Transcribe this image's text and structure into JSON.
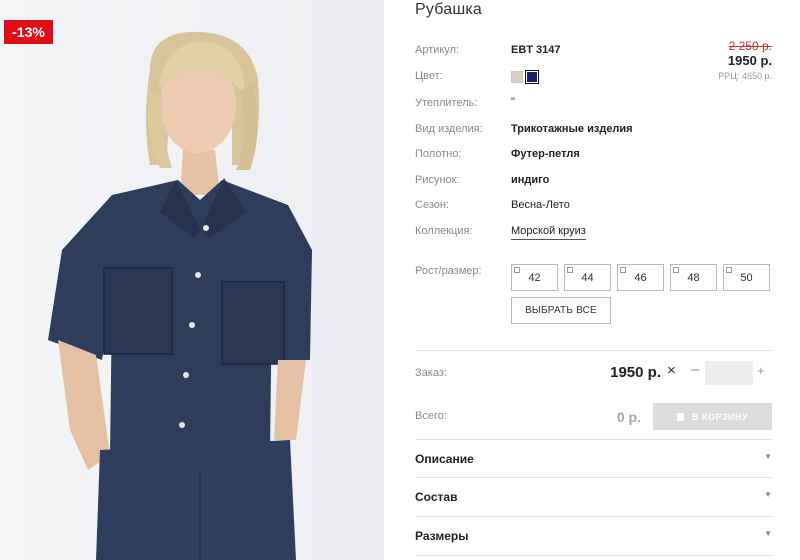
{
  "badge": {
    "discount": "-13%"
  },
  "product": {
    "title": "Рубашка",
    "attributes": [
      {
        "label": "Артикул:",
        "value": "EBT 3147"
      },
      {
        "label": "Цвет:",
        "value": ""
      },
      {
        "label": "Утеплитель:",
        "value": "\""
      },
      {
        "label": "Вид изделия:",
        "value": "Трикотажные изделия"
      },
      {
        "label": "Полотно:",
        "value": "Футер-петля"
      },
      {
        "label": "Рисунок:",
        "value": "индиго"
      },
      {
        "label": "Сезон:",
        "value": "Весна-Лето"
      },
      {
        "label": "Коллекция:",
        "value": "Морской круиз"
      }
    ],
    "colors": [
      {
        "name": "beige",
        "hex": "#d8cfc2"
      },
      {
        "name": "navy",
        "hex": "#1c1f6d",
        "selected": true
      }
    ]
  },
  "price": {
    "old": "2 250 р.",
    "new": "1950 р.",
    "rrc": "РРЦ: 4650 р."
  },
  "sizes": {
    "label": "Рост/размер:",
    "options": [
      "42",
      "44",
      "46",
      "48",
      "50"
    ],
    "select_all": "ВЫБРАТЬ ВСЕ"
  },
  "order": {
    "label": "Заказ:",
    "unit_price": "1950 р.",
    "times": "×",
    "minus": "–",
    "plus": "+",
    "quantity": "",
    "total_label": "Всего:",
    "total_value": "0 р.",
    "cart_button": "В КОРЗИНУ"
  },
  "accordion": [
    {
      "label": "Описание"
    },
    {
      "label": "Состав"
    },
    {
      "label": "Размеры"
    }
  ],
  "colors": {
    "sale_red": "#e10d16",
    "old_price_red": "#c0322f",
    "cart_disabled": "#dcdcdc"
  }
}
